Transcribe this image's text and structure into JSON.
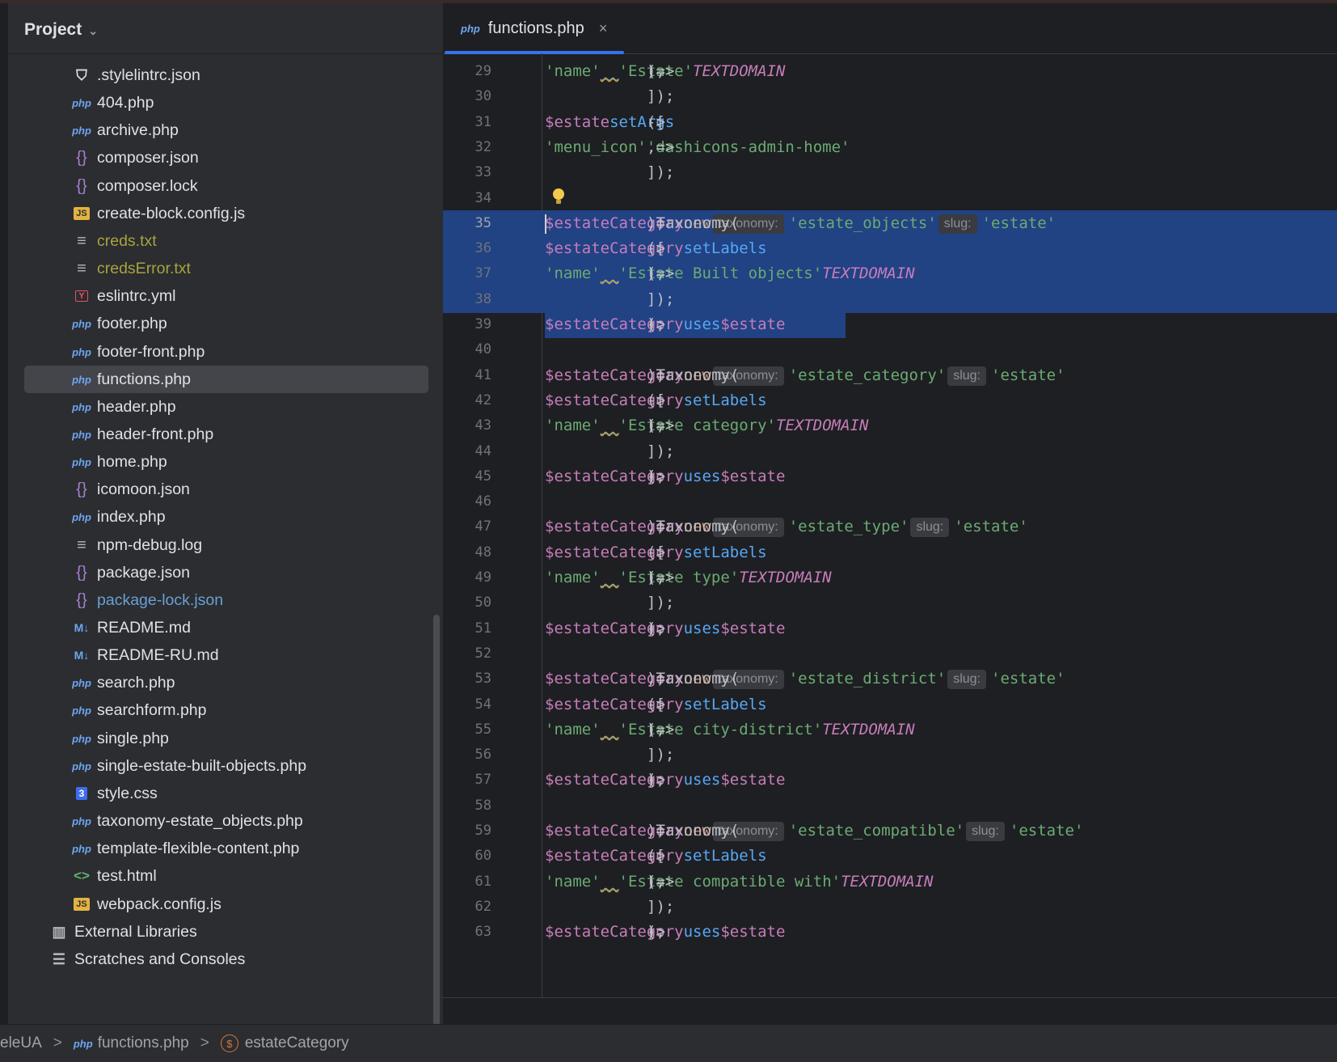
{
  "project_header": {
    "label": "Project"
  },
  "tree": [
    {
      "label": ".stylelintrc.json",
      "icon": "stylelint-icon",
      "glyph": "⛉",
      "type": "style"
    },
    {
      "label": "404.php",
      "icon": "php-file-icon",
      "glyph": "php",
      "type": "php"
    },
    {
      "label": "archive.php",
      "icon": "php-file-icon",
      "glyph": "php",
      "type": "php"
    },
    {
      "label": "composer.json",
      "icon": "json-file-icon",
      "glyph": "{}",
      "type": "json"
    },
    {
      "label": "composer.lock",
      "icon": "json-file-icon",
      "glyph": "{}",
      "type": "json"
    },
    {
      "label": "create-block.config.js",
      "icon": "js-file-icon",
      "glyph": "JS",
      "type": "js"
    },
    {
      "label": "creds.txt",
      "icon": "text-file-icon",
      "glyph": "≡",
      "type": "text",
      "status": "olive"
    },
    {
      "label": "credsError.txt",
      "icon": "text-file-icon",
      "glyph": "≡",
      "type": "text",
      "status": "olive"
    },
    {
      "label": "eslintrc.yml",
      "icon": "yml-file-icon",
      "glyph": "Y",
      "type": "yml"
    },
    {
      "label": "footer.php",
      "icon": "php-file-icon",
      "glyph": "php",
      "type": "php"
    },
    {
      "label": "footer-front.php",
      "icon": "php-file-icon",
      "glyph": "php",
      "type": "php"
    },
    {
      "label": "functions.php",
      "icon": "php-file-icon",
      "glyph": "php",
      "type": "php",
      "selected": true
    },
    {
      "label": "header.php",
      "icon": "php-file-icon",
      "glyph": "php",
      "type": "php"
    },
    {
      "label": "header-front.php",
      "icon": "php-file-icon",
      "glyph": "php",
      "type": "php"
    },
    {
      "label": "home.php",
      "icon": "php-file-icon",
      "glyph": "php",
      "type": "php"
    },
    {
      "label": "icomoon.json",
      "icon": "json-file-icon",
      "glyph": "{}",
      "type": "json"
    },
    {
      "label": "index.php",
      "icon": "php-file-icon",
      "glyph": "php",
      "type": "php"
    },
    {
      "label": "npm-debug.log",
      "icon": "text-file-icon",
      "glyph": "≡",
      "type": "text"
    },
    {
      "label": "package.json",
      "icon": "json-file-icon",
      "glyph": "{}",
      "type": "json"
    },
    {
      "label": "package-lock.json",
      "icon": "json-file-icon",
      "glyph": "{}",
      "type": "json",
      "status": "blue"
    },
    {
      "label": "README.md",
      "icon": "markdown-file-icon",
      "glyph": "M↓",
      "type": "md"
    },
    {
      "label": "README-RU.md",
      "icon": "markdown-file-icon",
      "glyph": "M↓",
      "type": "md"
    },
    {
      "label": "search.php",
      "icon": "php-file-icon",
      "glyph": "php",
      "type": "php"
    },
    {
      "label": "searchform.php",
      "icon": "php-file-icon",
      "glyph": "php",
      "type": "php"
    },
    {
      "label": "single.php",
      "icon": "php-file-icon",
      "glyph": "php",
      "type": "php"
    },
    {
      "label": "single-estate-built-objects.php",
      "icon": "php-file-icon",
      "glyph": "php",
      "type": "php"
    },
    {
      "label": "style.css",
      "icon": "css-file-icon",
      "glyph": "3",
      "type": "css"
    },
    {
      "label": "taxonomy-estate_objects.php",
      "icon": "php-file-icon",
      "glyph": "php",
      "type": "php"
    },
    {
      "label": "template-flexible-content.php",
      "icon": "php-file-icon",
      "glyph": "php",
      "type": "php"
    },
    {
      "label": "test.html",
      "icon": "html-file-icon",
      "glyph": "<>",
      "type": "html"
    },
    {
      "label": "webpack.config.js",
      "icon": "js-file-icon",
      "glyph": "JS",
      "type": "js"
    },
    {
      "label": "External Libraries",
      "icon": "library-icon",
      "glyph": "▥",
      "type": "lib",
      "root": true
    },
    {
      "label": "Scratches and Consoles",
      "icon": "scratches-icon",
      "glyph": "☰",
      "type": "scr",
      "root": true
    }
  ],
  "editor": {
    "tab": {
      "icon_text": "php",
      "label": "functions.php",
      "close": "×"
    },
    "current_line": 35,
    "lines": [
      {
        "n": 29,
        "tokens": [
          [
            "txt",
            "    "
          ],
          [
            "str",
            "'name'"
          ],
          [
            "txt",
            " => "
          ],
          [
            "dunder",
            "__"
          ],
          [
            "txt",
            "("
          ],
          [
            "str",
            "'Estate'"
          ],
          [
            "txt",
            ","
          ],
          [
            "const",
            "TEXTDOMAIN"
          ],
          [
            "txt",
            "),"
          ]
        ]
      },
      {
        "n": 30,
        "tokens": [
          [
            "txt",
            "]);"
          ]
        ]
      },
      {
        "n": 31,
        "tokens": [
          [
            "var",
            "$estate"
          ],
          [
            "txt",
            "->"
          ],
          [
            "fn",
            "setArgs"
          ],
          [
            "txt",
            "(["
          ]
        ]
      },
      {
        "n": 32,
        "tokens": [
          [
            "txt",
            "    "
          ],
          [
            "str",
            "'menu_icon'"
          ],
          [
            "txt",
            " => "
          ],
          [
            "str",
            "'dashicons-admin-home'"
          ],
          [
            "txt",
            ","
          ]
        ]
      },
      {
        "n": 33,
        "tokens": [
          [
            "txt",
            "]);"
          ]
        ]
      },
      {
        "n": 34,
        "tokens": [],
        "bulb": true
      },
      {
        "n": 35,
        "sel": true,
        "caret": true,
        "tokens": [
          [
            "var",
            "$estateCategory"
          ],
          [
            "txt",
            " = "
          ],
          [
            "kw",
            "new"
          ],
          [
            "txt",
            " Taxonomy("
          ],
          [
            "hint",
            "taxonomy:"
          ],
          [
            "str",
            "'estate_objects'"
          ],
          [
            "txt",
            ", "
          ],
          [
            "hint",
            "slug:"
          ],
          [
            "str",
            "'estate'"
          ],
          [
            "txt",
            ");"
          ]
        ]
      },
      {
        "n": 36,
        "sel": true,
        "tokens": [
          [
            "var",
            "$estateCategory"
          ],
          [
            "txt",
            "->"
          ],
          [
            "fn",
            "setLabels"
          ],
          [
            "txt",
            "(["
          ]
        ]
      },
      {
        "n": 37,
        "sel": true,
        "tokens": [
          [
            "txt",
            "    "
          ],
          [
            "str",
            "'name'"
          ],
          [
            "txt",
            " => "
          ],
          [
            "dunder",
            "__"
          ],
          [
            "txt",
            "("
          ],
          [
            "str",
            "'Estate Built objects'"
          ],
          [
            "txt",
            ","
          ],
          [
            "const",
            "TEXTDOMAIN"
          ],
          [
            "txt",
            "),"
          ]
        ]
      },
      {
        "n": 38,
        "sel": true,
        "tokens": [
          [
            "txt",
            "]);"
          ]
        ]
      },
      {
        "n": 39,
        "selpartial": true,
        "tokens": [
          [
            "var",
            "$estateCategory"
          ],
          [
            "txt",
            "->"
          ],
          [
            "fn",
            "uses"
          ],
          [
            "txt",
            "("
          ],
          [
            "var",
            "$estate"
          ],
          [
            "txt",
            ");"
          ]
        ]
      },
      {
        "n": 40,
        "tokens": []
      },
      {
        "n": 41,
        "tokens": [
          [
            "var",
            "$estateCategory"
          ],
          [
            "txt",
            " = "
          ],
          [
            "kw",
            "new"
          ],
          [
            "txt",
            " Taxonomy("
          ],
          [
            "hint",
            "taxonomy:"
          ],
          [
            "str",
            "'estate_category'"
          ],
          [
            "txt",
            ", "
          ],
          [
            "hint",
            "slug:"
          ],
          [
            "str",
            "'estate'"
          ],
          [
            "txt",
            ");"
          ]
        ]
      },
      {
        "n": 42,
        "tokens": [
          [
            "var",
            "$estateCategory"
          ],
          [
            "txt",
            "->"
          ],
          [
            "fn",
            "setLabels"
          ],
          [
            "txt",
            "(["
          ]
        ]
      },
      {
        "n": 43,
        "tokens": [
          [
            "txt",
            "    "
          ],
          [
            "str",
            "'name'"
          ],
          [
            "txt",
            " => "
          ],
          [
            "dunder",
            "__"
          ],
          [
            "txt",
            "("
          ],
          [
            "str",
            "'Estate category'"
          ],
          [
            "txt",
            ","
          ],
          [
            "const",
            "TEXTDOMAIN"
          ],
          [
            "txt",
            "),"
          ]
        ]
      },
      {
        "n": 44,
        "tokens": [
          [
            "txt",
            "]);"
          ]
        ]
      },
      {
        "n": 45,
        "tokens": [
          [
            "var",
            "$estateCategory"
          ],
          [
            "txt",
            "->"
          ],
          [
            "fn",
            "uses"
          ],
          [
            "txt",
            "("
          ],
          [
            "var",
            "$estate"
          ],
          [
            "txt",
            ");"
          ]
        ]
      },
      {
        "n": 46,
        "tokens": []
      },
      {
        "n": 47,
        "tokens": [
          [
            "var",
            "$estateCategory"
          ],
          [
            "txt",
            " = "
          ],
          [
            "kw",
            "new"
          ],
          [
            "txt",
            " Taxonomy("
          ],
          [
            "hint",
            "taxonomy:"
          ],
          [
            "str",
            "'estate_type'"
          ],
          [
            "txt",
            ", "
          ],
          [
            "hint",
            "slug:"
          ],
          [
            "str",
            "'estate'"
          ],
          [
            "txt",
            ");"
          ]
        ]
      },
      {
        "n": 48,
        "tokens": [
          [
            "var",
            "$estateCategory"
          ],
          [
            "txt",
            "->"
          ],
          [
            "fn",
            "setLabels"
          ],
          [
            "txt",
            "(["
          ]
        ]
      },
      {
        "n": 49,
        "tokens": [
          [
            "txt",
            "    "
          ],
          [
            "str",
            "'name'"
          ],
          [
            "txt",
            " => "
          ],
          [
            "dunder",
            "__"
          ],
          [
            "txt",
            "("
          ],
          [
            "str",
            "'Estate type'"
          ],
          [
            "txt",
            ","
          ],
          [
            "const",
            "TEXTDOMAIN"
          ],
          [
            "txt",
            "),"
          ]
        ]
      },
      {
        "n": 50,
        "tokens": [
          [
            "txt",
            "]);"
          ]
        ]
      },
      {
        "n": 51,
        "tokens": [
          [
            "var",
            "$estateCategory"
          ],
          [
            "txt",
            "->"
          ],
          [
            "fn",
            "uses"
          ],
          [
            "txt",
            "("
          ],
          [
            "var",
            "$estate"
          ],
          [
            "txt",
            ");"
          ]
        ]
      },
      {
        "n": 52,
        "tokens": []
      },
      {
        "n": 53,
        "tokens": [
          [
            "var",
            "$estateCategory"
          ],
          [
            "txt",
            " = "
          ],
          [
            "kw",
            "new"
          ],
          [
            "txt",
            " Taxonomy("
          ],
          [
            "hint",
            "taxonomy:"
          ],
          [
            "str",
            "'estate_district'"
          ],
          [
            "txt",
            ", "
          ],
          [
            "hint",
            "slug:"
          ],
          [
            "str",
            "'estate'"
          ],
          [
            "txt",
            ");"
          ]
        ]
      },
      {
        "n": 54,
        "tokens": [
          [
            "var",
            "$estateCategory"
          ],
          [
            "txt",
            "->"
          ],
          [
            "fn",
            "setLabels"
          ],
          [
            "txt",
            "(["
          ]
        ]
      },
      {
        "n": 55,
        "tokens": [
          [
            "txt",
            "    "
          ],
          [
            "str",
            "'name'"
          ],
          [
            "txt",
            " => "
          ],
          [
            "dunder",
            "__"
          ],
          [
            "txt",
            "("
          ],
          [
            "str",
            "'Estate city-district'"
          ],
          [
            "txt",
            ","
          ],
          [
            "const",
            "TEXTDOMAIN"
          ],
          [
            "txt",
            "),"
          ]
        ]
      },
      {
        "n": 56,
        "tokens": [
          [
            "txt",
            "]);"
          ]
        ]
      },
      {
        "n": 57,
        "tokens": [
          [
            "var",
            "$estateCategory"
          ],
          [
            "txt",
            "->"
          ],
          [
            "fn",
            "uses"
          ],
          [
            "txt",
            "("
          ],
          [
            "var",
            "$estate"
          ],
          [
            "txt",
            ");"
          ]
        ]
      },
      {
        "n": 58,
        "tokens": []
      },
      {
        "n": 59,
        "tokens": [
          [
            "var",
            "$estateCategory"
          ],
          [
            "txt",
            " = "
          ],
          [
            "kw",
            "new"
          ],
          [
            "txt",
            " Taxonomy("
          ],
          [
            "hint",
            "taxonomy:"
          ],
          [
            "str",
            "'estate_compatible'"
          ],
          [
            "txt",
            ", "
          ],
          [
            "hint",
            "slug:"
          ],
          [
            "str",
            "'estate'"
          ],
          [
            "txt",
            ");"
          ]
        ]
      },
      {
        "n": 60,
        "tokens": [
          [
            "var",
            "$estateCategory"
          ],
          [
            "txt",
            "->"
          ],
          [
            "fn",
            "setLabels"
          ],
          [
            "txt",
            "(["
          ]
        ]
      },
      {
        "n": 61,
        "tokens": [
          [
            "txt",
            "    "
          ],
          [
            "str",
            "'name'"
          ],
          [
            "txt",
            " => "
          ],
          [
            "dunder",
            "__"
          ],
          [
            "txt",
            "("
          ],
          [
            "str",
            "'Estate compatible with'"
          ],
          [
            "txt",
            ","
          ],
          [
            "const",
            "TEXTDOMAIN"
          ],
          [
            "txt",
            "),"
          ]
        ]
      },
      {
        "n": 62,
        "tokens": [
          [
            "txt",
            "]);"
          ]
        ]
      },
      {
        "n": 63,
        "tokens": [
          [
            "var",
            "$estateCategory"
          ],
          [
            "txt",
            "->"
          ],
          [
            "fn",
            "uses"
          ],
          [
            "txt",
            "("
          ],
          [
            "var",
            "$estate"
          ],
          [
            "txt",
            ");"
          ]
        ]
      }
    ]
  },
  "statusbar": {
    "crumb_project": "eleUA",
    "crumb_file_icon": "php",
    "crumb_file": "functions.php",
    "crumb_symbol_icon": "$",
    "crumb_symbol": "estateCategory",
    "separator": ">"
  },
  "colors": {
    "background": "#1e1f22",
    "panel": "#2b2d30",
    "selection": "#214283",
    "accent": "#3574f0",
    "variable": "#c77dbb",
    "function": "#56a8f5",
    "keyword": "#cf8e6d",
    "string": "#6aab73"
  }
}
